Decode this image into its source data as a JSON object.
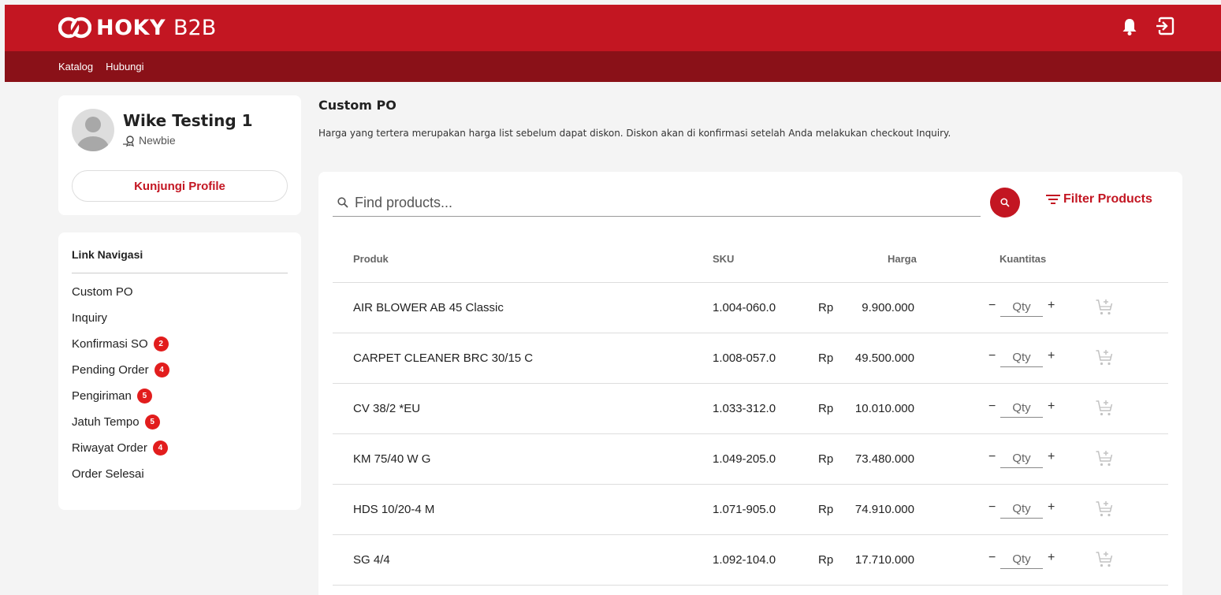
{
  "brand": {
    "name": "HOKY",
    "sub": "B2B",
    "accent": "#c31622",
    "dark_accent": "#8a1118"
  },
  "header": {
    "bell_icon": "bell-icon",
    "logout_icon": "logout-icon"
  },
  "nav": {
    "items": [
      "Katalog",
      "Hubungi"
    ]
  },
  "profile": {
    "name": "Wike Testing 1",
    "level": "Newbie",
    "button": "Kunjungi Profile"
  },
  "sidebar": {
    "title": "Link Navigasi",
    "items": [
      {
        "label": "Custom PO",
        "badge": ""
      },
      {
        "label": "Inquiry",
        "badge": ""
      },
      {
        "label": "Konfirmasi SO",
        "badge": "2"
      },
      {
        "label": "Pending Order",
        "badge": "4"
      },
      {
        "label": "Pengiriman",
        "badge": "5"
      },
      {
        "label": "Jatuh Tempo",
        "badge": "5"
      },
      {
        "label": "Riwayat Order",
        "badge": "4"
      },
      {
        "label": "Order Selesai",
        "badge": ""
      }
    ]
  },
  "main": {
    "title": "Custom PO",
    "description": "Harga yang tertera merupakan harga list sebelum dapat diskon. Diskon akan di konfirmasi setelah Anda melakukan checkout Inquiry.",
    "search_placeholder": "Find products...",
    "filter_label": "Filter Products",
    "columns": {
      "product": "Produk",
      "sku": "SKU",
      "price": "Harga",
      "qty": "Kuantitas"
    },
    "qty_placeholder": "Qty",
    "minus": "−",
    "plus": "+",
    "rows": [
      {
        "name": "AIR BLOWER AB 45 Classic",
        "sku": "1.004-060.0",
        "currency": "Rp",
        "price": "9.900.000"
      },
      {
        "name": "CARPET CLEANER BRC 30/15 C",
        "sku": "1.008-057.0",
        "currency": "Rp",
        "price": "49.500.000"
      },
      {
        "name": "CV 38/2 *EU",
        "sku": "1.033-312.0",
        "currency": "Rp",
        "price": "10.010.000"
      },
      {
        "name": "KM 75/40 W G",
        "sku": "1.049-205.0",
        "currency": "Rp",
        "price": "73.480.000"
      },
      {
        "name": "HDS 10/20-4 M",
        "sku": "1.071-905.0",
        "currency": "Rp",
        "price": "74.910.000"
      },
      {
        "name": "SG 4/4",
        "sku": "1.092-104.0",
        "currency": "Rp",
        "price": "17.710.000"
      }
    ]
  }
}
